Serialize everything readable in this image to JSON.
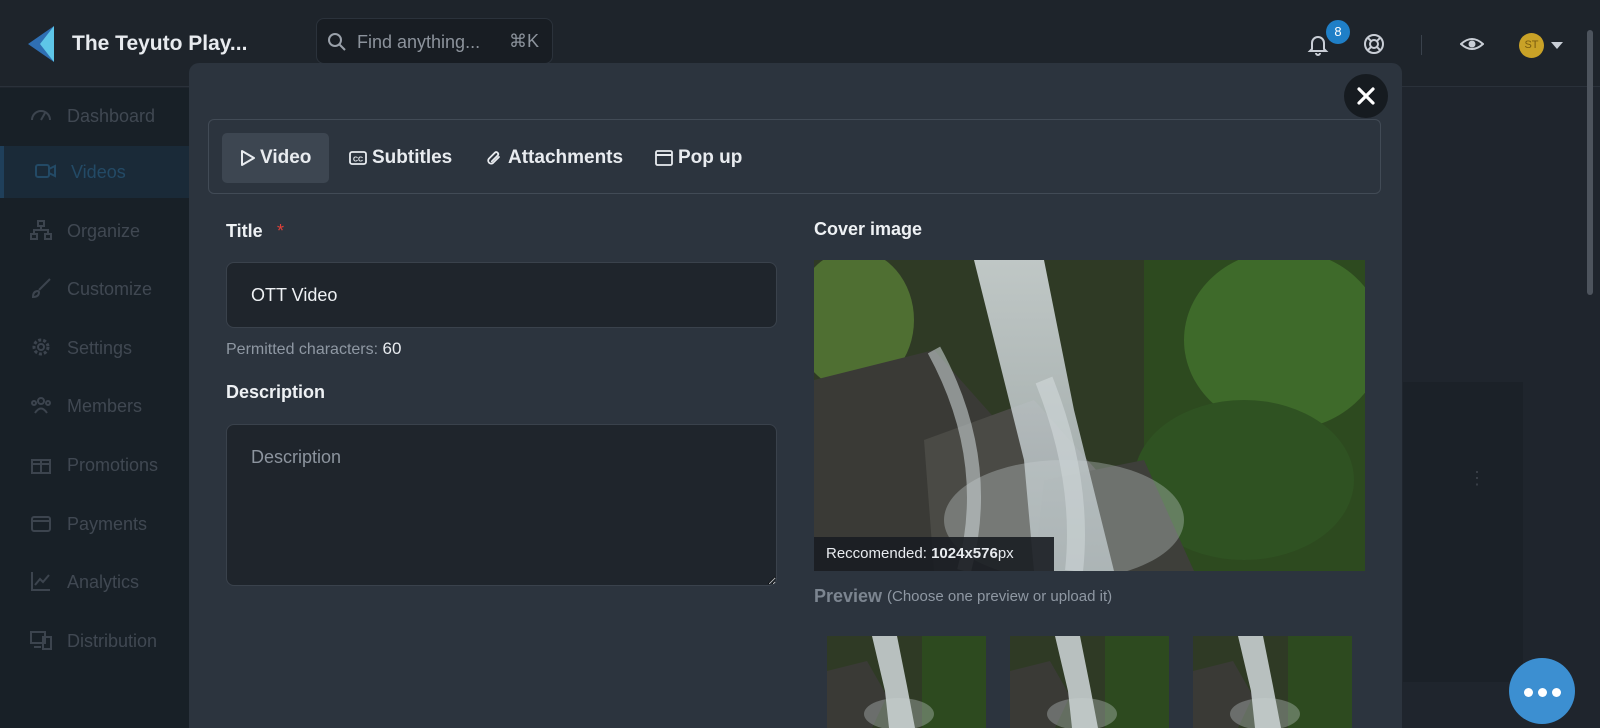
{
  "header": {
    "brand": "The Teyuto Play...",
    "search_placeholder": "Find anything...",
    "search_shortcut": "⌘K",
    "notifications_count": "8",
    "avatar_initials": "ST"
  },
  "sidebar": {
    "items": [
      {
        "label": "Dashboard",
        "icon": "dashboard-icon"
      },
      {
        "label": "Videos",
        "icon": "video-icon"
      },
      {
        "label": "Organize",
        "icon": "organize-icon"
      },
      {
        "label": "Customize",
        "icon": "brush-icon"
      },
      {
        "label": "Settings",
        "icon": "gear-icon"
      },
      {
        "label": "Members",
        "icon": "members-icon"
      },
      {
        "label": "Promotions",
        "icon": "gift-icon"
      },
      {
        "label": "Payments",
        "icon": "wallet-icon"
      },
      {
        "label": "Analytics",
        "icon": "chart-icon"
      },
      {
        "label": "Distribution",
        "icon": "devices-icon"
      }
    ],
    "active_index": 1
  },
  "modal": {
    "tabs": [
      {
        "label": "Video",
        "icon": "play-icon",
        "active": true
      },
      {
        "label": "Subtitles",
        "icon": "cc-icon",
        "active": false
      },
      {
        "label": "Attachments",
        "icon": "paperclip-icon",
        "active": false
      },
      {
        "label": "Pop up",
        "icon": "window-icon",
        "active": false
      }
    ],
    "title_label": "Title",
    "required_marker": "*",
    "title_value": "OTT Video",
    "permitted_label": "Permitted characters:",
    "permitted_value": "60",
    "description_label": "Description",
    "description_placeholder": "Description",
    "cover_label": "Cover image",
    "recommended_label": "Reccomended:",
    "recommended_value": "1024x576",
    "recommended_unit": "px",
    "preview_label": "Preview",
    "preview_hint": "(Choose one preview or upload it)"
  },
  "colors": {
    "modal_bg": "#2c343e",
    "accent_blue": "#1f7fc7",
    "required_red": "#e0413a",
    "chat_blue": "#3c8fd1"
  }
}
